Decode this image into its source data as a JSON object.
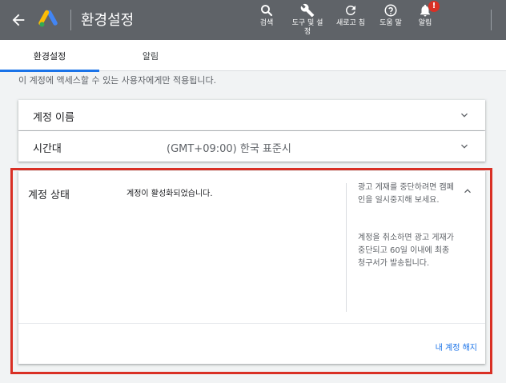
{
  "header": {
    "title": "환경설정",
    "tools": [
      {
        "icon": "search-icon",
        "label": "검색"
      },
      {
        "icon": "wrench-icon",
        "label": "도구 및 설정"
      },
      {
        "icon": "refresh-icon",
        "label": "새로고 침"
      },
      {
        "icon": "help-icon",
        "label": "도움 말"
      },
      {
        "icon": "bell-icon",
        "label": "알림",
        "badge": "!"
      }
    ]
  },
  "tabs": [
    {
      "label": "환경설정",
      "active": true
    },
    {
      "label": "알림",
      "active": false
    }
  ],
  "note": "이 계정에 액세스할 수 있는 사용자에게만 적용됩니다.",
  "settings": {
    "account_name": {
      "label": "계정 이름"
    },
    "timezone": {
      "label": "시간대",
      "value": "(GMT+09:00) 한국 표준시"
    },
    "account_status": {
      "label": "계정 상태",
      "value": "계정이 활성화되었습니다.",
      "help_pause": "광고 게재를 중단하려면 캠페인을 일시중지해 보세요.",
      "help_cancel": "계정을 취소하면 광고 게재가 중단되고 60일 이내에 최종 청구서가 발송됩니다.",
      "cancel_link": "내 계정 해지"
    }
  },
  "colors": {
    "topbar": "#5f6368",
    "accent": "#1a73e8",
    "highlight": "#d93025"
  }
}
